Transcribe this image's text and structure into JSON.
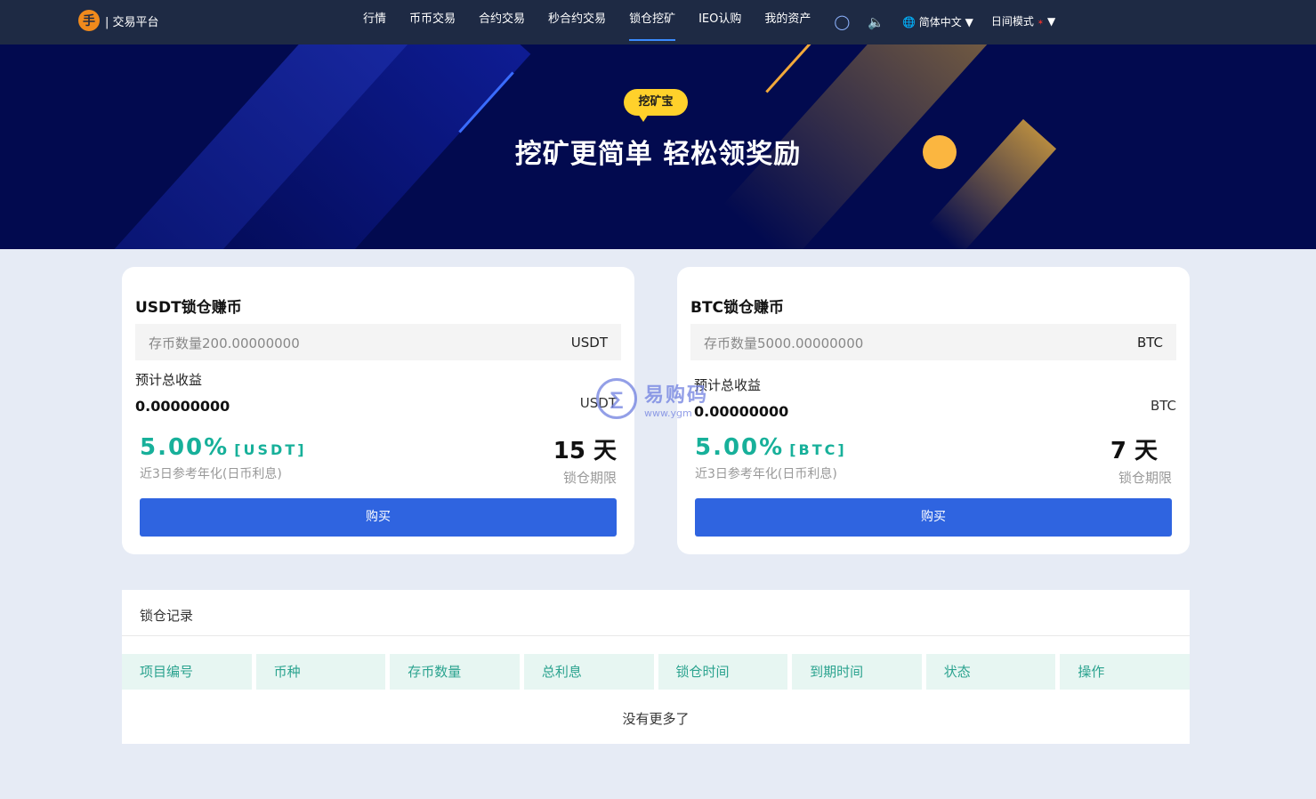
{
  "nav": {
    "logo_text": "| 交易平台",
    "logo_glyph": "手",
    "items": [
      {
        "label": "行情",
        "active": false
      },
      {
        "label": "币币交易",
        "active": false
      },
      {
        "label": "合约交易",
        "active": false
      },
      {
        "label": "秒合约交易",
        "active": false
      },
      {
        "label": "锁仓挖矿",
        "active": true
      },
      {
        "label": "IEO认购",
        "active": false
      },
      {
        "label": "我的资产",
        "active": false
      }
    ],
    "user_icon": "user-icon",
    "sound_icon": "speaker-icon",
    "language": "简体中文",
    "theme": "日间模式"
  },
  "banner": {
    "tag": "挖矿宝",
    "title": "挖矿更简单 轻松领奖励"
  },
  "cards": [
    {
      "title": "USDT锁仓赚币",
      "amount_placeholder": "存币数量200.00000000",
      "unit": "USDT",
      "est_label": "预计总收益",
      "est_value": "0.00000000",
      "rate": "5.00%",
      "rate_unit": "[USDT]",
      "rate_desc": "近3日参考年化(日币利息)",
      "days": "15 天",
      "days_label": "锁仓期限",
      "buy_label": "购买"
    },
    {
      "title": "BTC锁仓赚币",
      "amount_placeholder": "存币数量5000.00000000",
      "unit": "BTC",
      "est_label": "预计总收益",
      "est_value": "0.00000000",
      "rate": "5.00%",
      "rate_unit": "[BTC]",
      "rate_desc": "近3日参考年化(日币利息)",
      "days": "7 天",
      "days_label": "锁仓期限",
      "buy_label": "购买"
    }
  ],
  "records": {
    "title": "锁仓记录",
    "columns": [
      "项目编号",
      "币种",
      "存币数量",
      "总利息",
      "锁仓时间",
      "到期时间",
      "状态",
      "操作"
    ],
    "empty_text": "没有更多了"
  },
  "watermark": {
    "name": "易购码",
    "url": "www.ygm"
  },
  "colors": {
    "nav_bg": "#1e2a44",
    "banner_bg": "#020a4f",
    "accent_green": "#17b09a",
    "button_blue": "#2f64e0",
    "tag_yellow": "#ffd12b"
  }
}
